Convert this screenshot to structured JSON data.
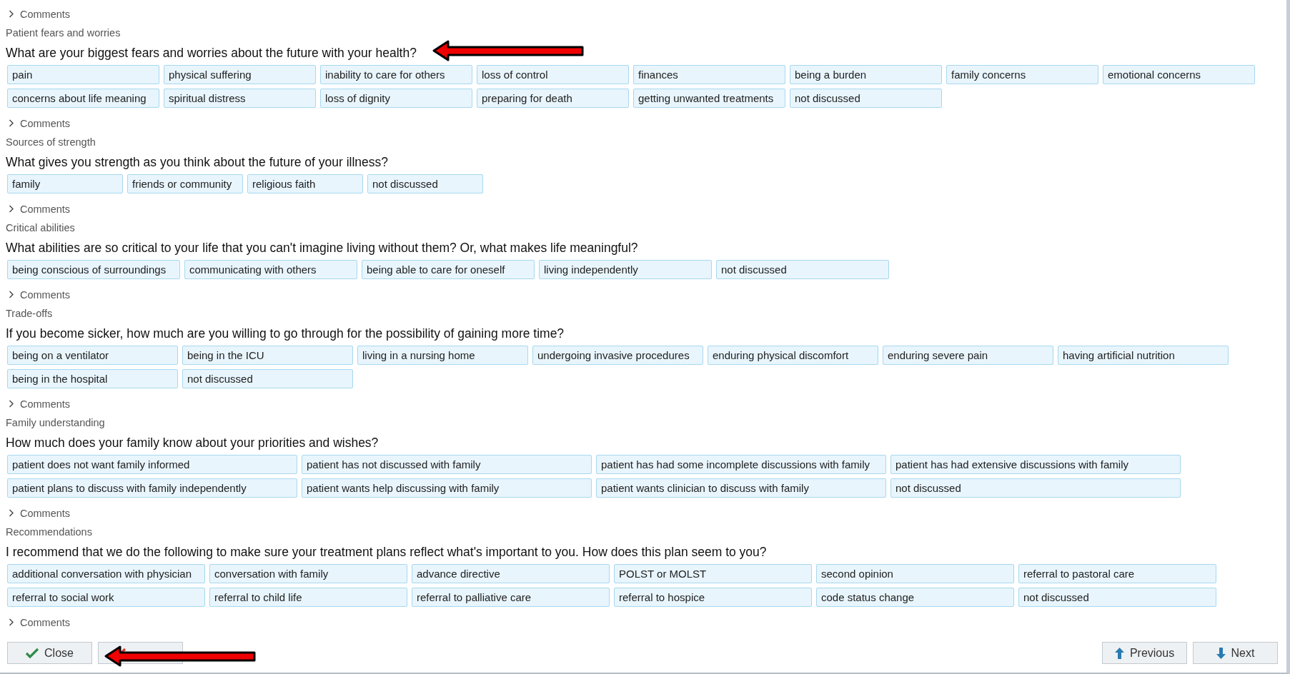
{
  "top_comments": "Comments",
  "sections": [
    {
      "label": "Patient fears and worries",
      "question": "What are your biggest fears and worries about the future with your health?",
      "options": [
        "pain",
        "physical suffering",
        "inability to care for others",
        "loss of control",
        "finances",
        "being a burden",
        "family concerns",
        "emotional concerns",
        "concerns about life meaning",
        "spiritual distress",
        "loss of dignity",
        "preparing for death",
        "getting unwanted treatments",
        "not discussed"
      ],
      "comments": "Comments"
    },
    {
      "label": "Sources of strength",
      "question": "What gives you strength as you think about the future of your illness?",
      "options": [
        "family",
        "friends or community",
        "religious faith",
        "not discussed"
      ],
      "comments": "Comments"
    },
    {
      "label": "Critical abilities",
      "question": "What abilities are so critical to your life that you can't imagine living without them? Or, what makes life meaningful?",
      "options": [
        "being conscious of surroundings",
        "communicating with others",
        "being able to care for oneself",
        "living independently",
        "not discussed"
      ],
      "comments": "Comments"
    },
    {
      "label": "Trade-offs",
      "question": "If you become sicker, how much are you willing to go through for the possibility of gaining more time?",
      "options": [
        "being on a ventilator",
        "being in the ICU",
        "living in a nursing home",
        "undergoing invasive procedures",
        "enduring physical discomfort",
        "enduring severe pain",
        "having artificial nutrition",
        "being in the hospital",
        "not discussed"
      ],
      "comments": "Comments"
    },
    {
      "label": "Family understanding",
      "question": "How much does your family know about your priorities and wishes?",
      "options": [
        "patient does not want family informed",
        "patient has not discussed with family",
        "patient has had some incomplete discussions with family",
        "patient has had extensive discussions with family",
        "patient plans to discuss with family independently",
        "patient wants help discussing with family",
        "patient wants clinician to discuss with family",
        "not discussed"
      ],
      "comments": "Comments"
    },
    {
      "label": "Recommendations",
      "question": "I recommend that we do the following to make sure your treatment plans reflect what's important to you. How does this plan seem to you?",
      "options": [
        "additional conversation with physician",
        "conversation with family",
        "advance directive",
        "POLST or MOLST",
        "second opinion",
        "referral to pastoral care",
        "referral to social work",
        "referral to child life",
        "referral to palliative care",
        "referral to hospice",
        "code status change",
        "not discussed"
      ],
      "comments": "Comments"
    }
  ],
  "left_buttons": [
    {
      "kind": "close",
      "label": "Close"
    },
    {
      "kind": "cancel"
    }
  ],
  "right_buttons": [
    {
      "kind": "previous",
      "label": "Previous"
    },
    {
      "kind": "next",
      "label": "Next"
    }
  ],
  "annotations": [
    {
      "kind": "arrow"
    },
    {
      "kind": "arrow"
    }
  ]
}
